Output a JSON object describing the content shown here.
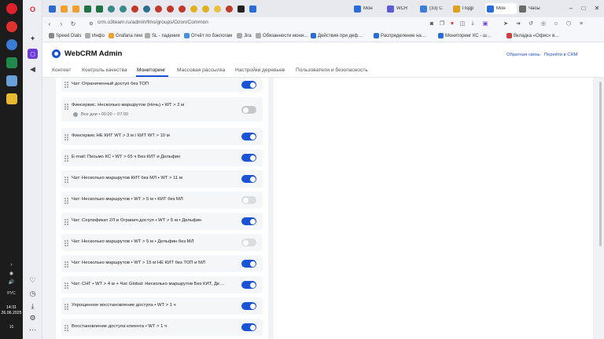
{
  "taskbar": {
    "lang": "РУС",
    "time": "14:31",
    "date": "26.06.2025",
    "notification_count": "10"
  },
  "browser": {
    "url": "crm.o3team.ru/admin/fms/groups/Ozon/Common",
    "tabs": [
      {
        "title": "",
        "color": "#2b6ccf"
      },
      {
        "title": "",
        "color": "#c0392b"
      },
      {
        "title": "",
        "color": "#217346"
      },
      {
        "title": "Мон",
        "color": "#2a6dd9"
      },
      {
        "title": "WCR",
        "color": "#5b5bd6"
      },
      {
        "title": "(33) С",
        "color": "#3b7dd8"
      },
      {
        "title": "Подр",
        "color": "#e0a020"
      },
      {
        "title": "Мон",
        "color": "#2a6dd9"
      },
      {
        "title": "Часы",
        "color": "#6b6b6b"
      }
    ],
    "bookmarks": [
      {
        "label": "Speed Dials",
        "color": "#888888"
      },
      {
        "label": "Инфо",
        "color": "#aaaaaa"
      },
      {
        "label": "Grafana new",
        "color": "#f0a030"
      },
      {
        "label": "SL - падения",
        "color": "#aaaaaa"
      },
      {
        "label": "Отчёт по бэклогам",
        "color": "#4a8fe0"
      },
      {
        "label": "Jira",
        "color": "#aaaaaa"
      },
      {
        "label": "Обязанности мони…",
        "color": "#aaaaaa"
      },
      {
        "label": "Действия при деф…",
        "color": "#2a6dd9"
      },
      {
        "label": "Распределение на…",
        "color": "#2a6dd9"
      },
      {
        "label": "Мониторинг КС - ш…",
        "color": "#2a6dd9"
      },
      {
        "label": "Вкладка «Офис» в…",
        "color": "#d04040"
      }
    ]
  },
  "crm": {
    "title": "WebCRM Admin",
    "feedback_link": "Обратная связь",
    "goto_crm_link": "Перейти в CRM",
    "nav_tabs": [
      "Контент",
      "Контроль качества",
      "Мониторинг",
      "Массовая рассылка",
      "Настройки деревьев",
      "Пользователи и безопасность"
    ],
    "active_tab": "Мониторинг"
  },
  "rules": [
    {
      "title": "Чат: Ограниченный доступ без ТОП",
      "state": "on"
    },
    {
      "title": "Финсервис. Несколько маршрутов (Ночь) • WT > 2 м",
      "schedule": "Все дни • 00:00 – 07:00",
      "state": "disabled"
    },
    {
      "title": "Финсервис НЕ КИТ WT > 3 м / КИТ WT > 10 м",
      "state": "on"
    },
    {
      "title": "E-mail: Письмо КС • WT > 65 ч Без КИТ и Дельфин",
      "state": "on"
    },
    {
      "title": "Чат: Несколько маршрутов КИТ без МЛ • WT > 11 м",
      "state": "on"
    },
    {
      "title": "Чат: Несколько маршрутов • WT > 5 м • КИТ без МЛ",
      "state": "off"
    },
    {
      "title": "Чат: Сертификат 2Л и Огранич.доступ • WT > 5 м • Дельфин",
      "state": "on"
    },
    {
      "title": "Чат: Несколько маршрутов • WT > 5 м • Дельфин без МЛ",
      "state": "off"
    },
    {
      "title": "Чат: Несколько маршрутов • WT > 15 м НЕ КИТ без ТОП и МЛ",
      "state": "on"
    },
    {
      "title": "Чат: СНГ • WT > 4 м + Чат Global: Несколько маршрутов Без КИТ, Де…",
      "state": "on"
    },
    {
      "title": "Упрощенное восстановление доступа • WT > 1 ч",
      "state": "on"
    },
    {
      "title": "Восстановление доступа клиента • WT > 1 ч",
      "state": "on"
    }
  ]
}
